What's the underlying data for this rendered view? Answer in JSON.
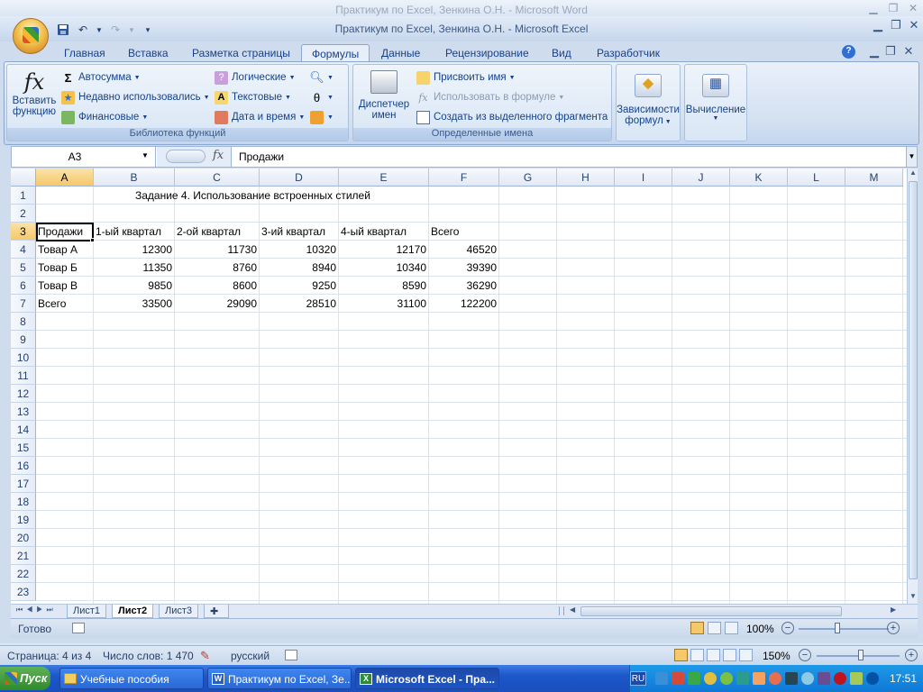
{
  "word": {
    "title": "Практикум по Excel, Зенкина О.Н. - Microsoft Word",
    "status": {
      "page": "Страница: 4 из 4",
      "words": "Число слов: 1 470",
      "language": "русский",
      "zoom": "150%"
    }
  },
  "excel": {
    "title": "Практикум по Excel, Зенкина О.Н. - Microsoft Excel",
    "tabs": [
      "Главная",
      "Вставка",
      "Разметка страницы",
      "Формулы",
      "Данные",
      "Рецензирование",
      "Вид",
      "Разработчик"
    ],
    "active_tab": "Формулы",
    "ribbon": {
      "insert_function": {
        "line1": "Вставить",
        "line2": "функцию"
      },
      "lib_items": {
        "autosum": "Автосумма",
        "recent": "Недавно использовались",
        "financial": "Финансовые",
        "logical": "Логические",
        "text": "Текстовые",
        "datetime": "Дата и время"
      },
      "lib_label": "Библиотека функций",
      "name_manager": {
        "line1": "Диспетчер",
        "line2": "имен"
      },
      "names_items": {
        "assign": "Присвоить имя",
        "use": "Использовать в формуле",
        "create": "Создать из выделенного фрагмента"
      },
      "names_label": "Определенные имена",
      "dependencies": {
        "line1": "Зависимости",
        "line2": "формул"
      },
      "calculation": "Вычисление"
    },
    "formula_bar": {
      "name_box": "A3",
      "fx": "fx",
      "value": "Продажи"
    },
    "columns": [
      "A",
      "B",
      "C",
      "D",
      "E",
      "F",
      "G",
      "H",
      "I",
      "J",
      "K",
      "L",
      "M"
    ],
    "rows": [
      "1",
      "2",
      "3",
      "4",
      "5",
      "6",
      "7",
      "8",
      "9",
      "10",
      "11",
      "12",
      "13",
      "14",
      "15",
      "16",
      "17",
      "18",
      "19",
      "20",
      "21",
      "22",
      "23"
    ],
    "sheet": {
      "title_cell": "Задание 4. Использование встроенных стилей",
      "headers": [
        "Продажи",
        "1-ый квартал",
        "2-ой квартал",
        "3-ий квартал",
        "4-ый квартал",
        "Всего"
      ],
      "data": [
        [
          "Товар А",
          "12300",
          "11730",
          "10320",
          "12170",
          "46520"
        ],
        [
          "Товар Б",
          "11350",
          "8760",
          "8940",
          "10340",
          "39390"
        ],
        [
          "Товар В",
          "9850",
          "8600",
          "9250",
          "8590",
          "36290"
        ],
        [
          "Всего",
          "33500",
          "29090",
          "28510",
          "31100",
          "122200"
        ]
      ]
    },
    "sheet_tabs": [
      "Лист1",
      "Лист2",
      "Лист3"
    ],
    "active_sheet": "Лист2",
    "status": {
      "ready": "Готово",
      "zoom": "100%"
    }
  },
  "taskbar": {
    "start": "Пуск",
    "items": [
      "Учебные пособия",
      "Практикум по Excel, Зе...",
      "Microsoft Excel - Пра..."
    ],
    "lang": "RU",
    "clock": "17:51"
  }
}
